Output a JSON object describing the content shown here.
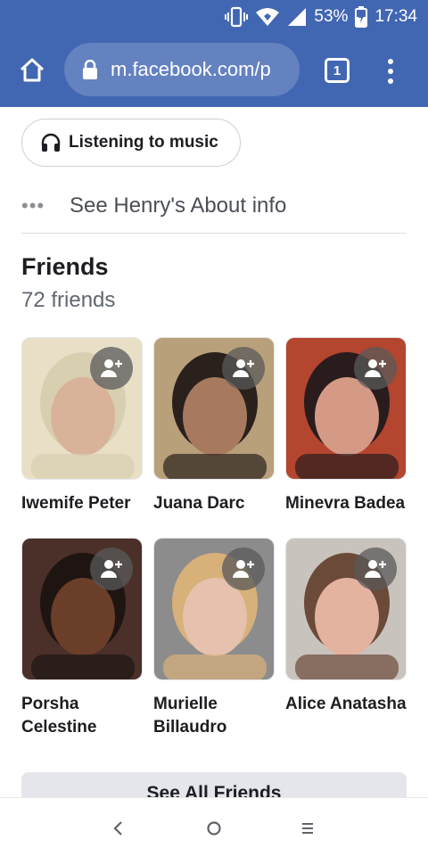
{
  "status": {
    "battery": "53%",
    "time": "17:34"
  },
  "browser": {
    "url": "m.facebook.com/p",
    "tab_count": "1"
  },
  "profile": {
    "activity": "Listening to music",
    "about_link": "See Henry's About info"
  },
  "friends": {
    "title": "Friends",
    "count": "72 friends",
    "list": [
      {
        "name": "Iwemife Peter",
        "colors": {
          "bg": "#e8dfc6",
          "skin": "#d9b29a",
          "hair": "#d8cfb0"
        }
      },
      {
        "name": "Juana Darc",
        "colors": {
          "bg": "#b8a07a",
          "skin": "#a77a60",
          "hair": "#2b211c"
        }
      },
      {
        "name": "Minevra Badea",
        "colors": {
          "bg": "#b4452f",
          "skin": "#d49a86",
          "hair": "#2a1c1c"
        }
      },
      {
        "name": "Porsha Celestine",
        "colors": {
          "bg": "#4a3028",
          "skin": "#6b3e2a",
          "hair": "#1e1512"
        }
      },
      {
        "name": "Murielle Billaudro",
        "colors": {
          "bg": "#8c8c8c",
          "skin": "#e6c1ae",
          "hair": "#d8b07a"
        }
      },
      {
        "name": "Alice Anatasha",
        "colors": {
          "bg": "#c9c3bd",
          "skin": "#e3b3a0",
          "hair": "#6b4a3a"
        }
      }
    ],
    "see_all": "See All Friends"
  },
  "colors": {
    "brand": "#4267b2",
    "text": "#1c1e21",
    "muted": "#606770"
  }
}
